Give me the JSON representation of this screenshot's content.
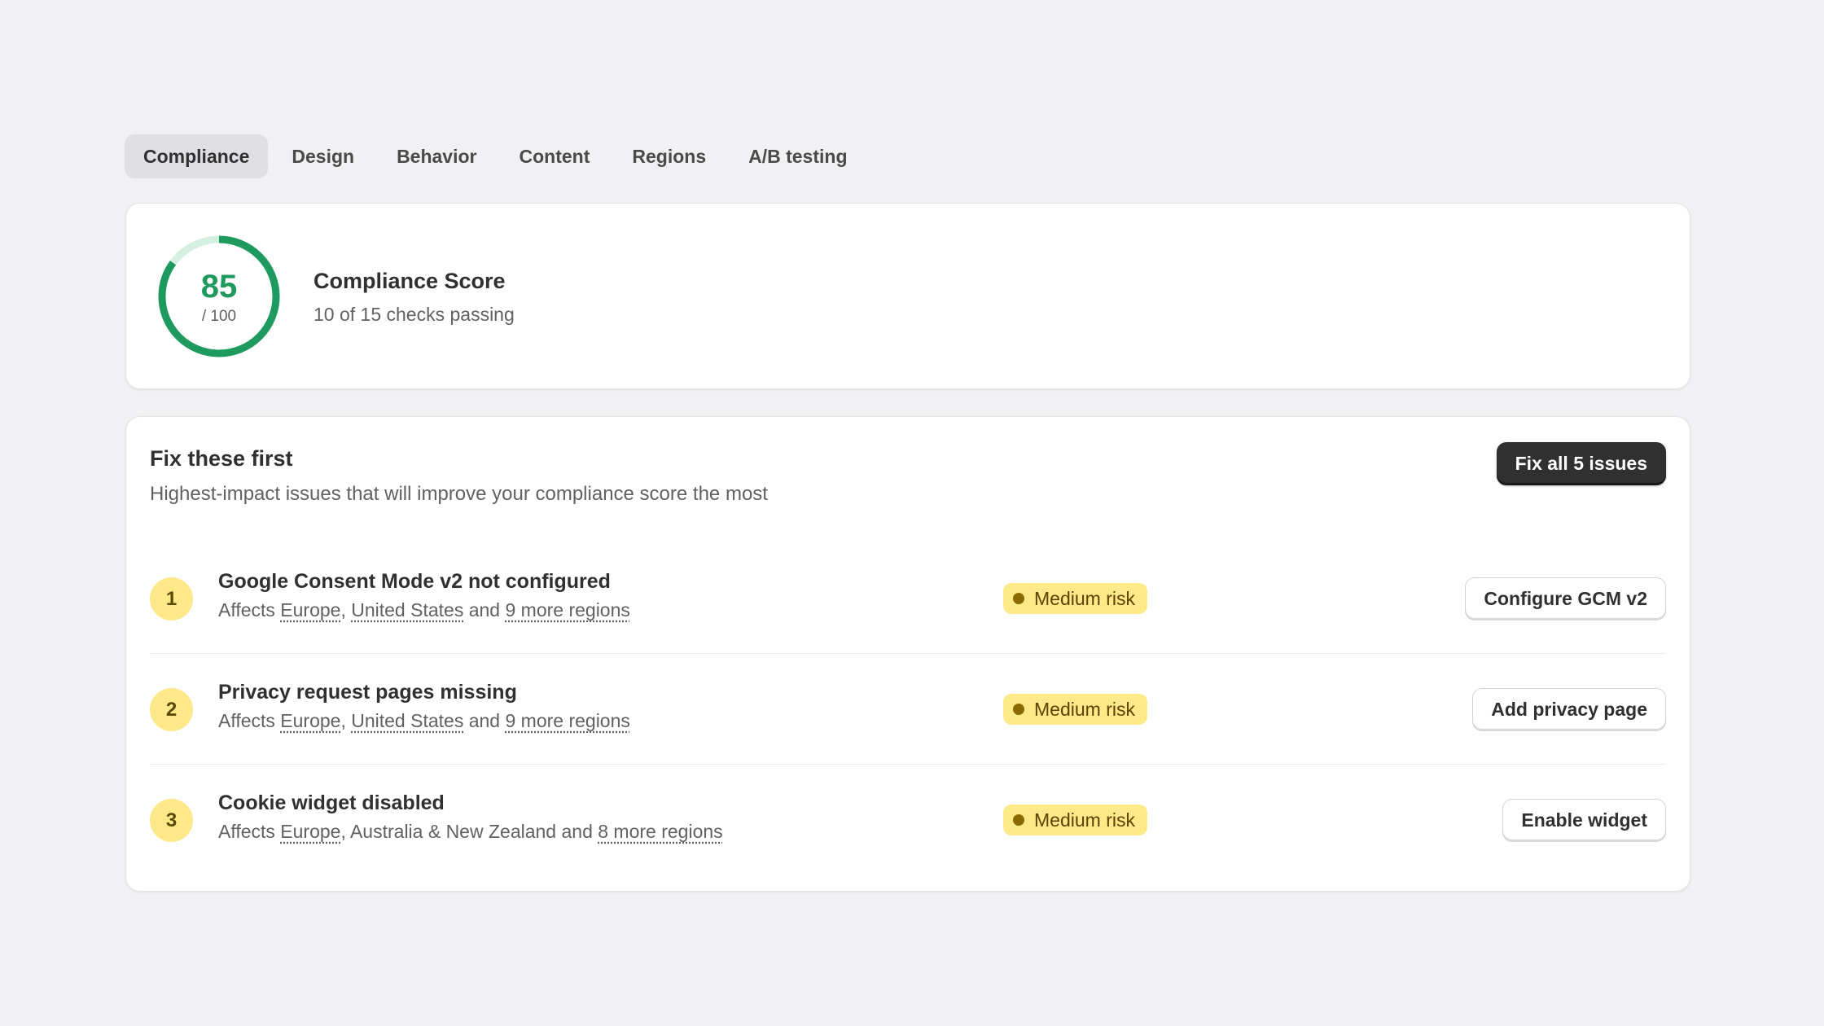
{
  "tabs": [
    "Compliance",
    "Design",
    "Behavior",
    "Content",
    "Regions",
    "A/B testing"
  ],
  "active_tab": "Compliance",
  "score": {
    "value": "85",
    "max_label": "/ 100",
    "fraction": 0.85,
    "title": "Compliance Score",
    "subtitle": "10 of 15 checks passing",
    "ring_color": "#1f9a5f",
    "ring_track_color": "#d5efe3"
  },
  "issues_panel": {
    "title": "Fix these first",
    "subtitle": "Highest-impact issues that will improve your compliance score the most",
    "fix_all_label": "Fix all 5 issues",
    "issues": [
      {
        "number": "1",
        "title": "Google Consent Mode v2 not configured",
        "affects_prefix": "Affects",
        "region_1": "Europe",
        "sep": ",",
        "region_2": "United States",
        "conj": "and",
        "more": "9 more regions",
        "risk": "Medium risk",
        "action": "Configure GCM v2"
      },
      {
        "number": "2",
        "title": "Privacy request pages missing",
        "affects_prefix": "Affects",
        "region_1": "Europe",
        "sep": ",",
        "region_2": "United States",
        "conj": "and",
        "more": "9 more regions",
        "risk": "Medium risk",
        "action": "Add privacy page"
      },
      {
        "number": "3",
        "title": "Cookie widget disabled",
        "affects_prefix": "Affects",
        "region_1": "Europe",
        "sep": ",",
        "region_2_plain": "Australia & New Zealand",
        "conj": "and",
        "more": "8 more regions",
        "risk": "Medium risk",
        "action": "Enable widget"
      }
    ]
  }
}
